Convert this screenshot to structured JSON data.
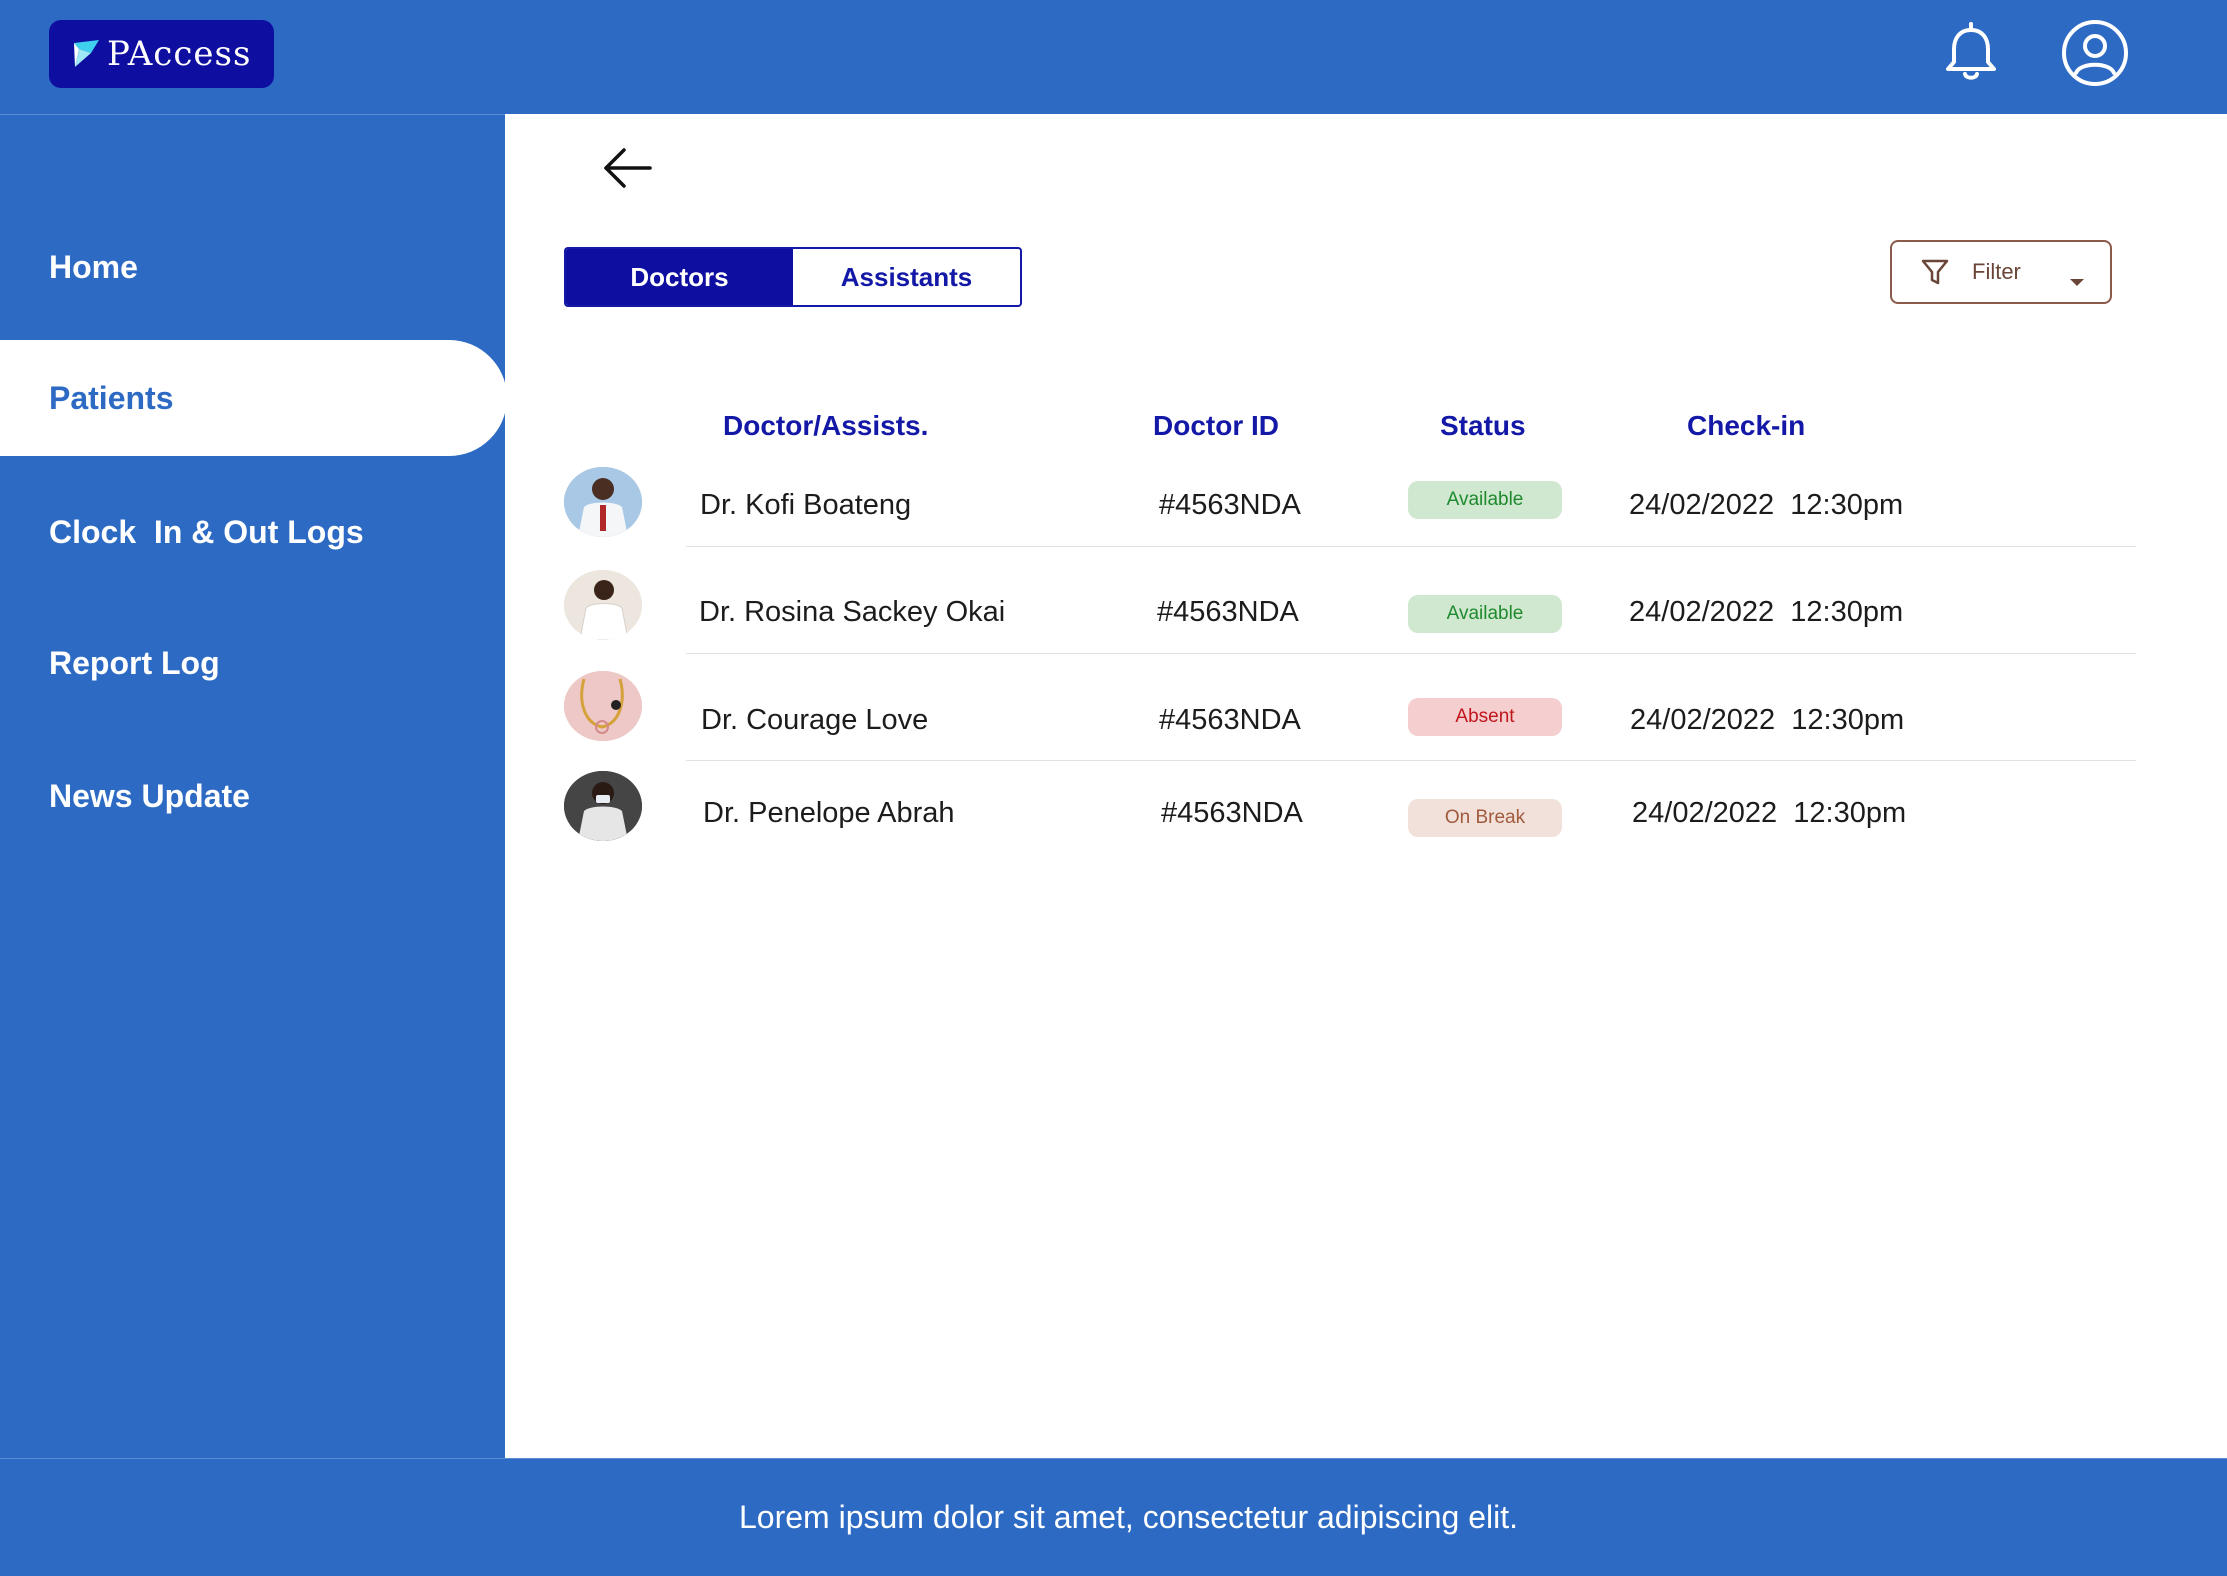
{
  "app": {
    "logo_text": "PAccess"
  },
  "sidebar": {
    "items": [
      {
        "label": "Home"
      },
      {
        "label": "Patients"
      },
      {
        "label": "Clock  In & Out Logs"
      },
      {
        "label": "Report Log"
      },
      {
        "label": "News Update"
      }
    ]
  },
  "tabs": [
    {
      "label": "Doctors"
    },
    {
      "label": "Assistants"
    }
  ],
  "filter": {
    "label": "Filter"
  },
  "table": {
    "headers": [
      "Doctor/Assists.",
      "Doctor ID",
      "Status",
      "Check-in"
    ],
    "rows": [
      {
        "name": "Dr. Kofi Boateng",
        "id": "#4563NDA",
        "status": "Available",
        "checkin": "24/02/2022  12:30pm"
      },
      {
        "name": "Dr. Rosina Sackey Okai",
        "id": "#4563NDA",
        "status": "Available",
        "checkin": "24/02/2022  12:30pm"
      },
      {
        "name": "Dr. Courage Love",
        "id": "#4563NDA",
        "status": "Absent",
        "checkin": "24/02/2022  12:30pm"
      },
      {
        "name": "Dr. Penelope Abrah",
        "id": "#4563NDA",
        "status": "On Break",
        "checkin": "24/02/2022  12:30pm"
      }
    ]
  },
  "footer": {
    "text": "Lorem ipsum dolor sit amet, consectetur adipiscing elit."
  },
  "colors": {
    "primary": "#2d6ac4",
    "navy": "#0e0fa0",
    "available_bg": "#cfe8cf",
    "available_text": "#1f8a2e",
    "absent_bg": "#f5cfd0",
    "absent_text": "#c0161c",
    "break_bg": "#f1e1da",
    "break_text": "#a05a3c"
  }
}
